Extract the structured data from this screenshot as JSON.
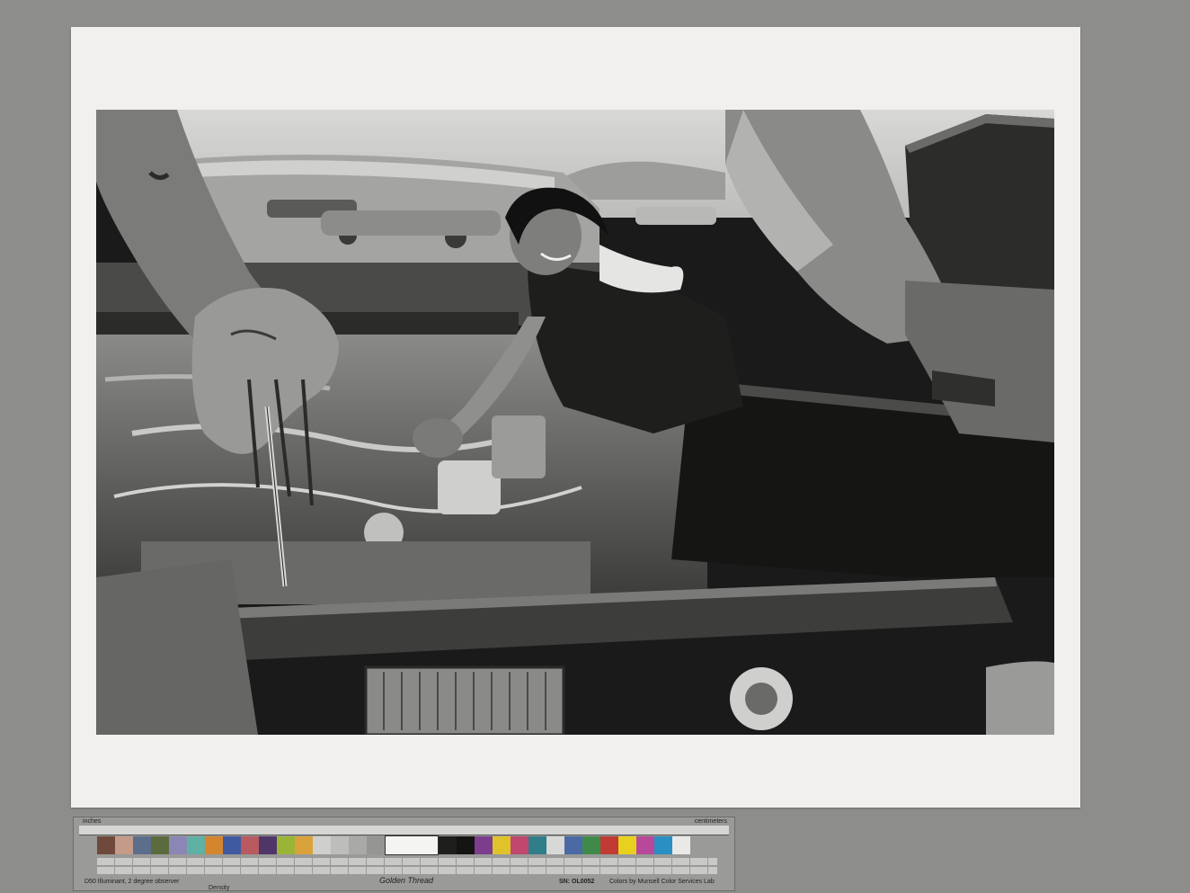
{
  "target": {
    "inches_label": "inches",
    "centimeters_label": "centimeters",
    "illuminant_label": "D50 Illuminant, 2 degree observer",
    "density_label": "Density",
    "brand_label": "Golden Thread",
    "serial_label": "SN: OL0052",
    "lab_label": "Colors by Munsell Color Services Lab",
    "swatch_colors": [
      "#6f4a3c",
      "#c49a88",
      "#5b6f8c",
      "#5b6b3d",
      "#8b87b5",
      "#5fb0a5",
      "#d6852f",
      "#3f5aa0",
      "#b85a5f",
      "#4f3669",
      "#9ab536",
      "#d9a23a",
      "#cfcfcd",
      "#bdbdbb",
      "#a9a9a7",
      "#959593",
      "#828280",
      "#70706e",
      "#5e5e5c",
      "#4c4c4a",
      "#3b3b39",
      "#2b2b29",
      "#1e1e1c",
      "#141412",
      "#7b3d8c",
      "#e0c22a",
      "#c0486f",
      "#2f7e8a",
      "#d8d8d6",
      "#4b6aa5",
      "#3f8a4a",
      "#c13a33",
      "#e8d11e",
      "#b8489a",
      "#2a8fc2",
      "#e9e9e7"
    ]
  }
}
